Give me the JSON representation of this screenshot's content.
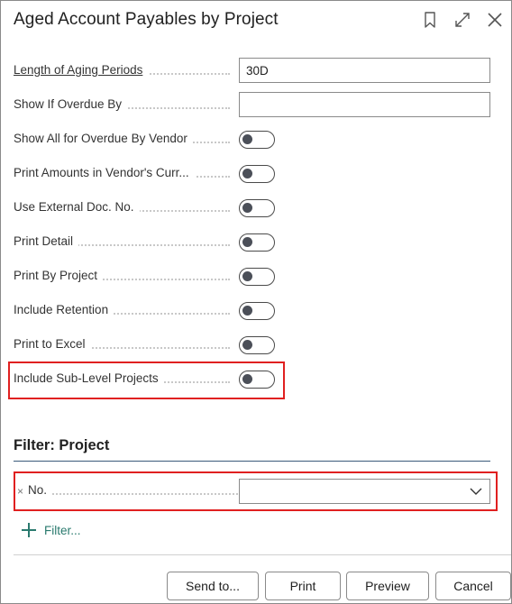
{
  "dialog": {
    "title": "Aged Account Payables by Project",
    "icons": [
      "bookmark-icon",
      "expand-icon",
      "close-icon"
    ]
  },
  "options": {
    "aging_periods": {
      "label": "Length of Aging Periods",
      "value": "30D"
    },
    "overdue_by": {
      "label": "Show If Overdue By",
      "value": ""
    },
    "toggles": [
      {
        "label": "Show All for Overdue By Vendor",
        "on": false
      },
      {
        "label": "Print Amounts in Vendor's Curr...",
        "on": false
      },
      {
        "label": "Use External Doc. No.",
        "on": false
      },
      {
        "label": "Print Detail",
        "on": false
      },
      {
        "label": "Print By Project",
        "on": false
      },
      {
        "label": "Include Retention",
        "on": false
      },
      {
        "label": "Print to Excel",
        "on": false
      },
      {
        "label": "Include Sub-Level Projects",
        "on": false
      }
    ]
  },
  "filter": {
    "section_title": "Filter: Project",
    "remove_symbol": "×",
    "field_label": "No.",
    "field_value": "",
    "add_filter_label": "Filter..."
  },
  "footer": {
    "send_to": "Send to...",
    "print": "Print",
    "preview": "Preview",
    "cancel": "Cancel"
  },
  "colors": {
    "highlight": "#e02020",
    "link_accent": "#2a7a6e"
  }
}
